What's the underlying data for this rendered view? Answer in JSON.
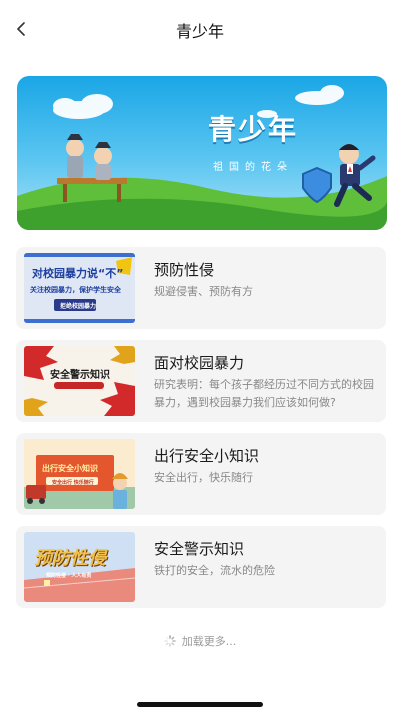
{
  "header": {
    "title": "青少年",
    "back_icon": "chevron-left-icon"
  },
  "banner": {
    "title": "青少年",
    "subtitle": "祖国的花朵"
  },
  "articles": [
    {
      "title": "预防性侵",
      "description": "规避侵害、预防有方",
      "thumb": {
        "line1": "对校园暴力说“不”",
        "line2": "关注校园暴力，保护学生安全",
        "line3": "拒绝校园暴力"
      }
    },
    {
      "title": "面对校园暴力",
      "description": "研究表明：每个孩子都经历过不同方式的校园暴力，遇到校园暴力我们应该如何做?",
      "thumb": {
        "line1": "安全警示知识"
      }
    },
    {
      "title": "出行安全小知识",
      "description": "安全出行，快乐随行",
      "thumb": {
        "line1": "出行安全小知识",
        "line2": "安全出行 快乐随行"
      }
    },
    {
      "title": "安全警示知识",
      "description": "铁打的安全，流水的危险",
      "thumb": {
        "line1": "预防性侵",
        "line2": "预防性侵 · 人人有责"
      }
    }
  ],
  "footer": {
    "loading_text": "加载更多..."
  },
  "colors": {
    "banner_sky": "#1aa6e6",
    "card_bg": "#f4f4f4",
    "desc_text": "#888888"
  }
}
